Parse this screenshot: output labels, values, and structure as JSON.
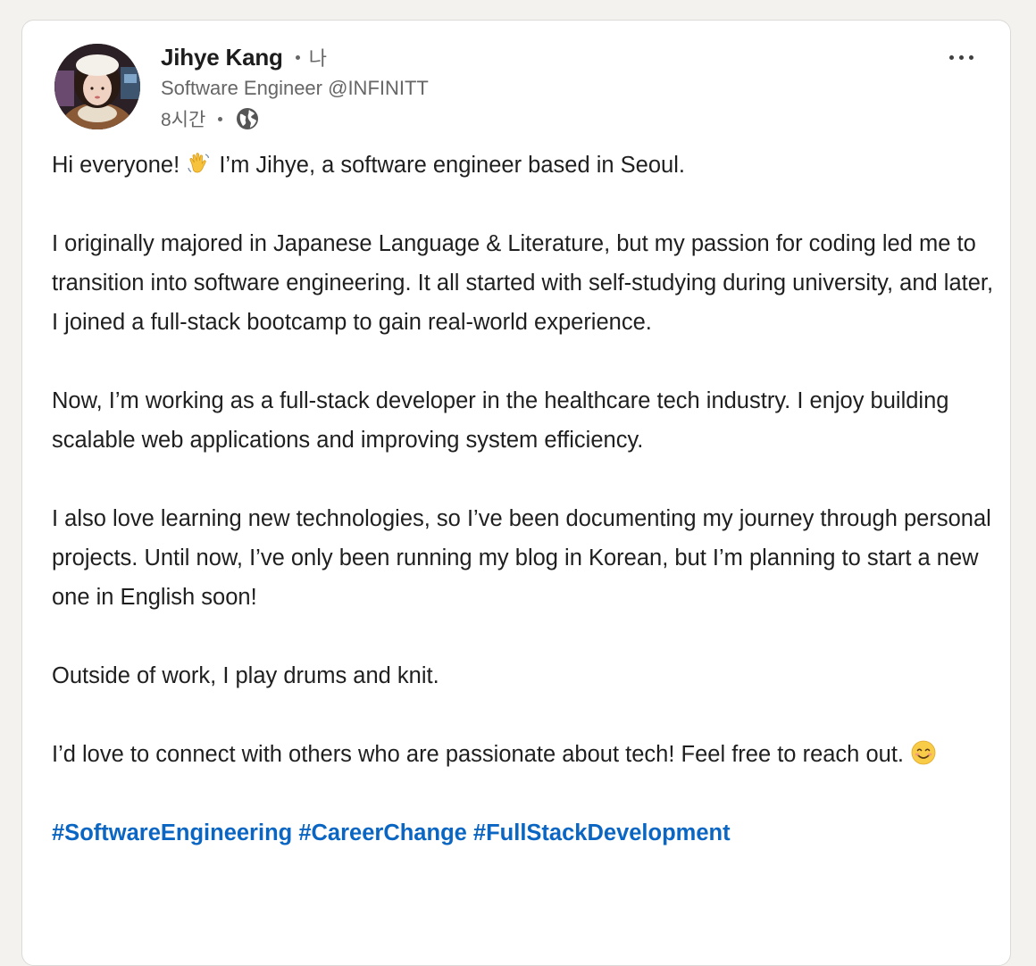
{
  "post": {
    "author": {
      "name": "Jihye Kang",
      "degree": "나",
      "headline": "Software Engineer @INFINITT",
      "time": "8시간",
      "visibility_icon": "globe-icon",
      "avatar_icon": "profile-photo"
    },
    "menu_icon": "more-options-icon",
    "paragraphs": {
      "p1_before": "Hi everyone! ",
      "p1_emoji": "waving-hand-emoji",
      "p1_after": " I’m Jihye, a software engineer based in Seoul.",
      "p2": "I originally majored in Japanese Language & Literature, but my passion for coding led me to transition into software engineering. It all started with self-studying during university, and later, I joined a full-stack bootcamp to gain real-world experience.",
      "p3": "Now, I’m working as a full-stack developer in the healthcare tech industry. I enjoy building scalable web applications and improving system efficiency.",
      "p4": "I also love learning new technologies, so I’ve been documenting my journey through personal projects. Until now, I’ve only been running my blog in Korean, but I’m planning to start a new one in English soon!",
      "p5": "Outside of work, I play drums and knit.",
      "p6_before": "I’d love to connect with others who are passionate about tech! Feel free to reach out. ",
      "p6_emoji": "smiling-face-emoji"
    },
    "hashtags": [
      "#SoftwareEngineering",
      "#CareerChange",
      "#FullStackDevelopment"
    ]
  },
  "colors": {
    "hashtag": "#0a66c2",
    "page_background": "#f4f2ee",
    "card_background": "#ffffff",
    "secondary_text": "#666666"
  }
}
